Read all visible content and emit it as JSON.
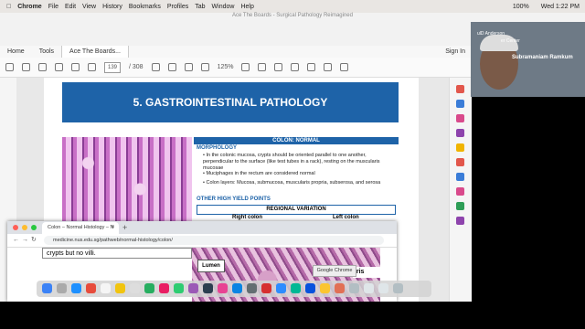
{
  "menubar": {
    "app": "Chrome",
    "items": [
      "File",
      "Edit",
      "View",
      "History",
      "Bookmarks",
      "Profiles",
      "Tab",
      "Window",
      "Help"
    ],
    "battery": "100%",
    "clock": "Wed 1:22 PM"
  },
  "acrobat": {
    "window_title": "Ace The Boards - Surgical Pathology Reimagined",
    "tabs": [
      "Home",
      "Tools",
      "Ace The Boards..."
    ],
    "signin": "Sign In",
    "page_current": "139",
    "page_total": "/ 308",
    "zoom": "125%"
  },
  "document": {
    "banner_title": "5. GASTROINTESTINAL PATHOLOGY",
    "section_header": "COLON: NORMAL",
    "morphology_heading": "MORPHOLOGY",
    "bullet1": "In the colonic mucosa, crypts should be oriented parallel to one another, perpendicular to the surface (like test tubes in a rack), resting on the muscularis mucosae",
    "bullet2": "Muciphages in the rectum are considered normal",
    "bullet3": "Colon layers: Mucosa, submucosa, muscularis propria, subserosa, and serosa",
    "other_heading": "OTHER HIGH YIELD POINTS",
    "regional": "REGIONAL VARIATION",
    "right_colon": "Right colon",
    "left_colon": "Left colon"
  },
  "webcam": {
    "name": "Subramaniam Ramkum",
    "overlay1": "ulD Anderson",
    "overlay2": "er Center"
  },
  "chrome": {
    "tab_title": "Colon – Normal Histology – N",
    "tab_close": "×",
    "new_tab": "+",
    "url": "medicine.nus.edu.sg/pathweb/normal-histology/colon/",
    "crypts_text": "crypts but no villi.",
    "lumen_label": "Lumen",
    "tooltip": "Google Chrome",
    "partial_label": "aris"
  },
  "colors": {
    "banner": "#1e63a8",
    "accent": "#1e63a8"
  }
}
